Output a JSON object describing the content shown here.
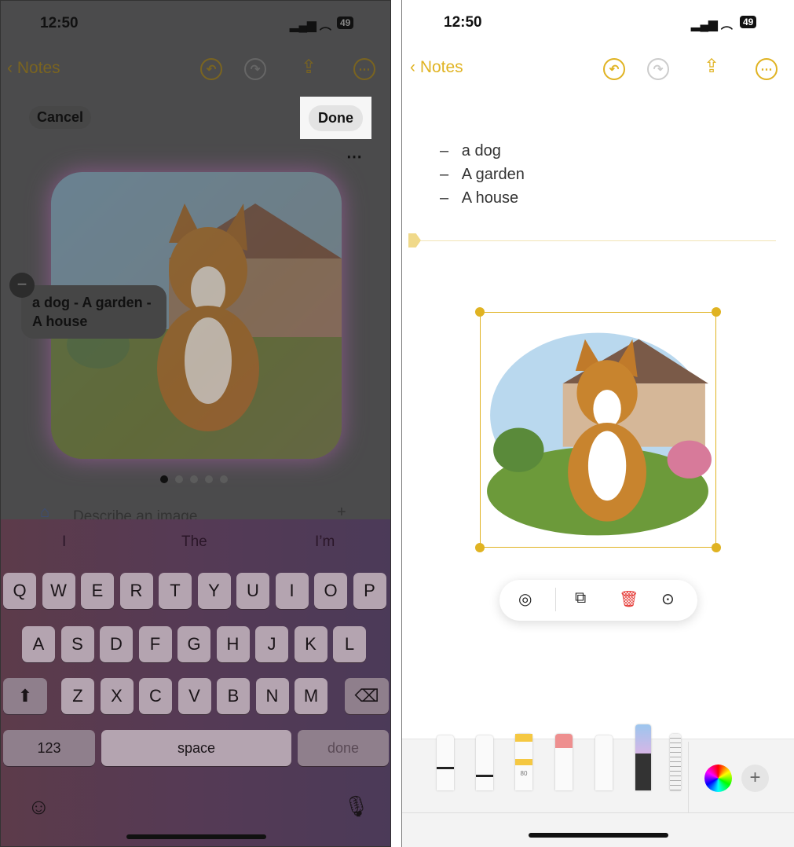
{
  "left": {
    "status": {
      "time": "12:50",
      "battery": "49"
    },
    "nav": {
      "back_label": "Notes"
    },
    "cancel_label": "Cancel",
    "done_label": "Done",
    "image_caption": "a dog - A garden - A house",
    "page_dots": {
      "count": 5,
      "active": 1
    },
    "prompt_placeholder": "Describe an image",
    "suggestions": [
      "I",
      "The",
      "I’m"
    ],
    "keyboard": {
      "row1": [
        "Q",
        "W",
        "E",
        "R",
        "T",
        "Y",
        "U",
        "I",
        "O",
        "P"
      ],
      "row2": [
        "A",
        "S",
        "D",
        "F",
        "G",
        "H",
        "J",
        "K",
        "L"
      ],
      "row3": [
        "Z",
        "X",
        "C",
        "V",
        "B",
        "N",
        "M"
      ],
      "numbers_label": "123",
      "space_label": "space",
      "done_label": "done"
    }
  },
  "right": {
    "status": {
      "time": "12:50",
      "battery": "49"
    },
    "nav": {
      "back_label": "Notes"
    },
    "list": [
      "a dog",
      "A garden",
      "A house"
    ],
    "toolbar_icons": [
      "markup-icon",
      "duplicate-icon",
      "trash-icon",
      "more-icon"
    ],
    "highlighter_label": "80",
    "accent": "#e0b322"
  }
}
